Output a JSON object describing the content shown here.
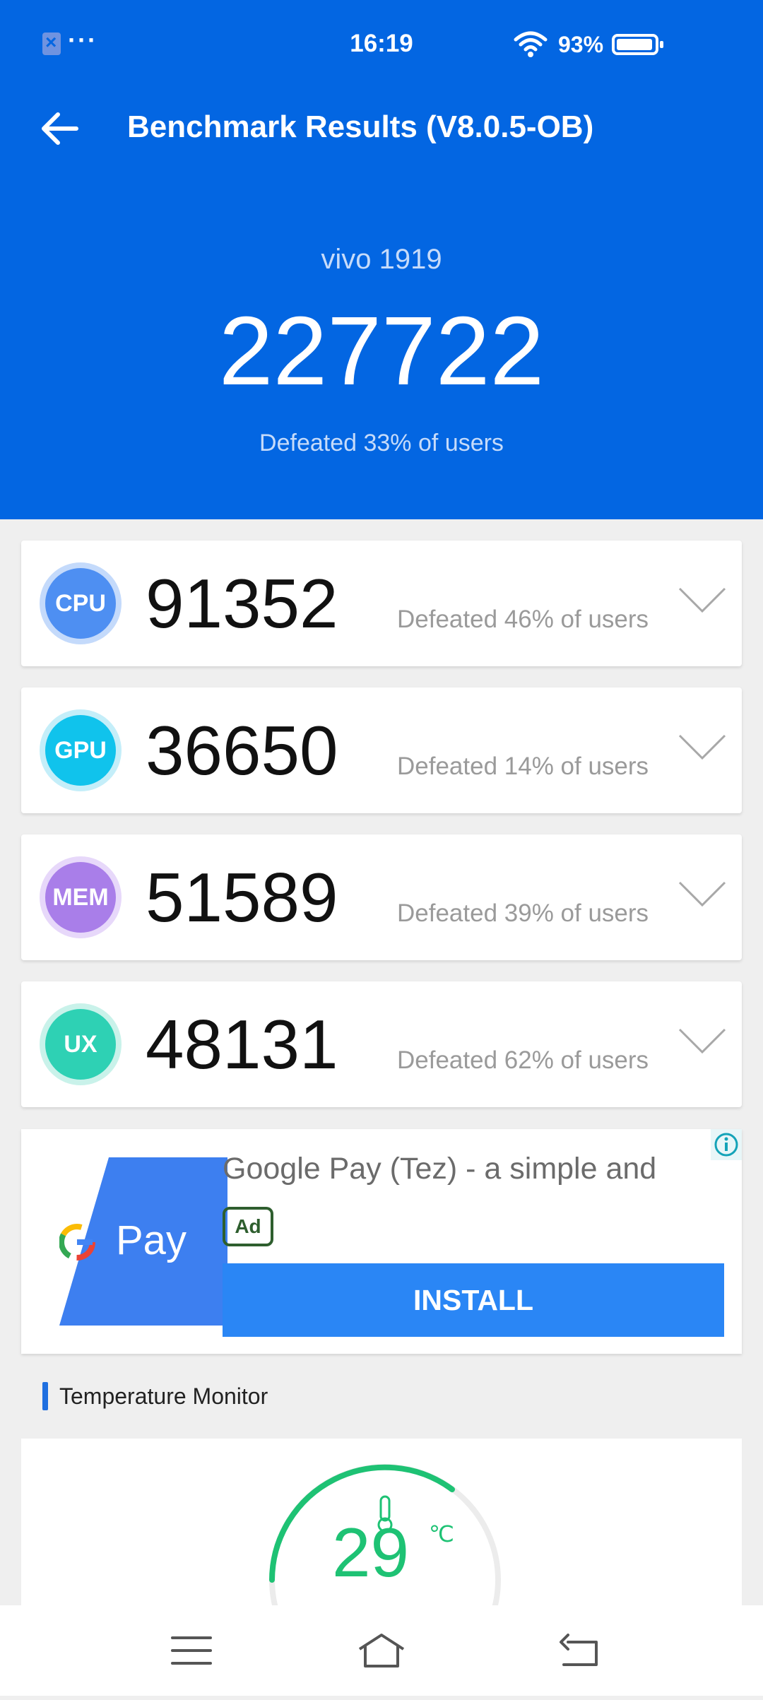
{
  "status_bar": {
    "time": "16:19",
    "battery": "93%",
    "icons": [
      "notification-x-icon",
      "more-dots-icon",
      "wifi-icon",
      "battery-icon"
    ]
  },
  "header": {
    "title": "Benchmark Results (V8.0.5-OB)",
    "device": "vivo 1919",
    "total_score": "227722",
    "total_defeated": "Defeated 33% of users",
    "background": "#0366e2"
  },
  "scores": [
    {
      "label": "CPU",
      "score": "91352",
      "defeated": "Defeated 46% of users",
      "color": "#4e8ff2",
      "ring": "#c4dafb"
    },
    {
      "label": "GPU",
      "score": "36650",
      "defeated": "Defeated 14% of users",
      "color": "#10c3ec",
      "ring": "#c4eef9"
    },
    {
      "label": "MEM",
      "score": "51589",
      "defeated": "Defeated 39% of users",
      "color": "#a97ee9",
      "ring": "#e7d8fa"
    },
    {
      "label": "UX",
      "score": "48131",
      "defeated": "Defeated 62% of users",
      "color": "#2ed1b4",
      "ring": "#c9f2ea"
    }
  ],
  "ad": {
    "title": "Google Pay (Tez) - a simple and",
    "badge": "Ad",
    "install": "INSTALL",
    "logo_text": "Pay"
  },
  "temperature": {
    "section_title": "Temperature Monitor",
    "value": "29",
    "unit": "℃",
    "color": "#1ec274"
  },
  "nav": {
    "icons": [
      "menu-icon",
      "home-icon",
      "back-nav-icon"
    ]
  }
}
